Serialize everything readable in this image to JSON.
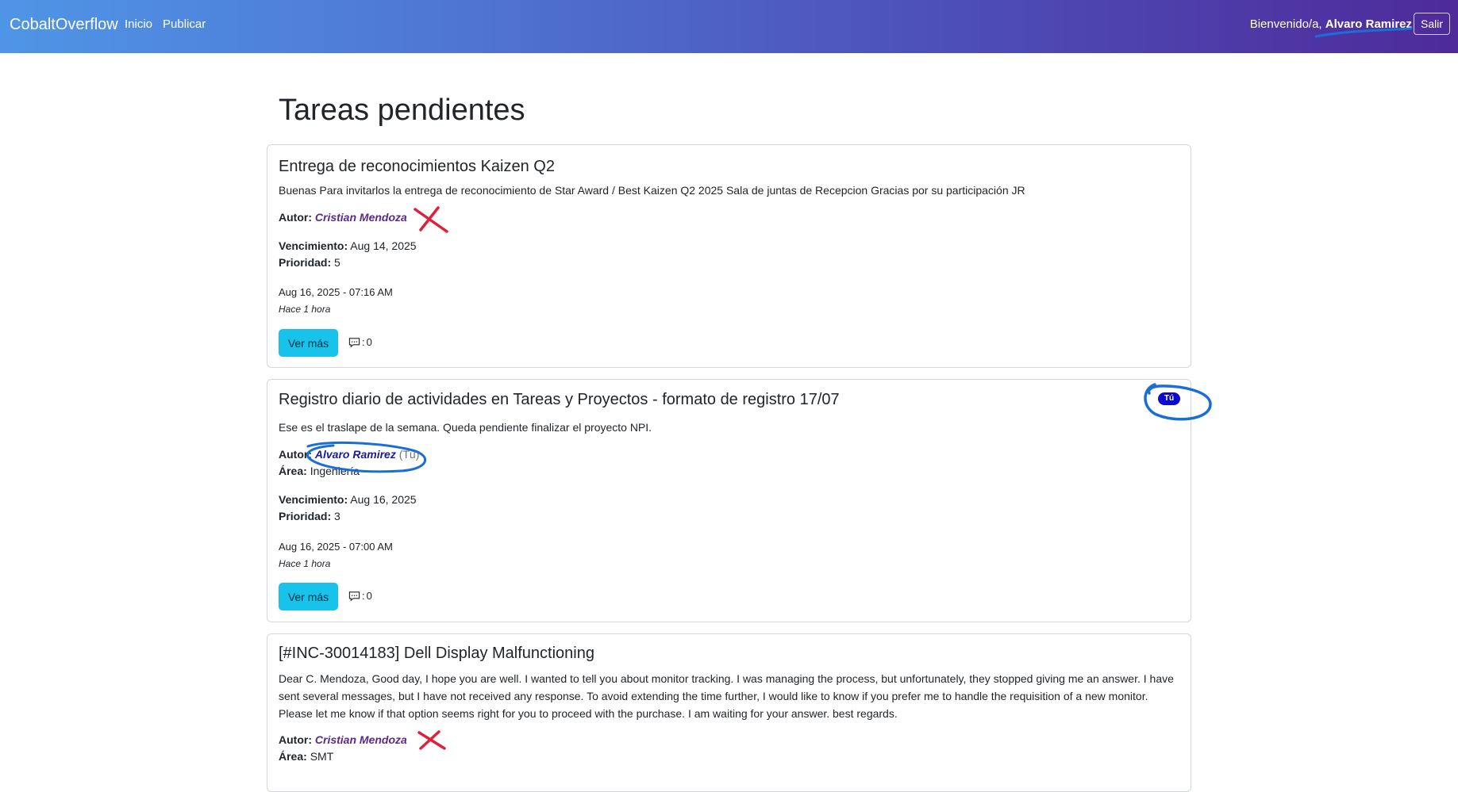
{
  "navbar": {
    "brand": "CobaltOverflow",
    "links": [
      "Inicio",
      "Publicar"
    ],
    "welcome_prefix": "Bienvenido/a, ",
    "user_name": "Alvaro Ramirez",
    "logout_label": "Salir"
  },
  "page": {
    "title": "Tareas pendientes"
  },
  "labels": {
    "author": "Autor:",
    "area": "Área:",
    "due": "Vencimiento:",
    "priority": "Prioridad:",
    "more_button": "Ver más",
    "you_suffix": "(Tú)",
    "you_badge": "Tú",
    "comments_sep": ": "
  },
  "tasks": [
    {
      "title": "Entrega de reconocimientos Kaizen Q2",
      "description": "Buenas Para invitarlos la entrega de reconocimiento de Star Award / Best Kaizen Q2 2025 Sala de juntas de Recepcion Gracias por su participación JR",
      "author": "Cristian Mendoza",
      "due": "Aug 14, 2025",
      "priority": "5",
      "datetime": "Aug 16, 2025 - 07:16 AM",
      "ago": "Hace 1 hora",
      "comments": "0"
    },
    {
      "title": "Registro diario de actividades en Tareas y Proyectos - formato de registro 17/07",
      "description": "Ese es el traslape de la semana. Queda pendiente finalizar el proyecto NPI.",
      "author": "Alvaro Ramirez",
      "area": "Ingeniería",
      "due": "Aug 16, 2025",
      "priority": "3",
      "datetime": "Aug 16, 2025 - 07:00 AM",
      "ago": "Hace 1 hora",
      "comments": "0"
    },
    {
      "title": "[#INC-30014183] Dell Display Malfunctioning",
      "description": "Dear C. Mendoza, Good day, I hope you are well. I wanted to tell you about monitor tracking. I was managing the process, but unfortunately, they stopped giving me an answer. I have sent several messages, but I have not received any response. To avoid extending the time further, I would like to know if you prefer me to handle the requisition of a new monitor. Please let me know if that option seems right for you to proceed with the purchase. I am waiting for your answer. best regards.",
      "author": "Cristian Mendoza",
      "area": "SMT"
    }
  ],
  "icons": {
    "comment": "comment-icon"
  },
  "colors": {
    "nav_start": "#4f95e6",
    "nav_end": "#4e2a9a",
    "button": "#17c3eb",
    "author": "#5a2a8a",
    "badge": "#0b0bd0",
    "annotation_red": "#e0203a",
    "annotation_blue": "#1a6fd6"
  }
}
